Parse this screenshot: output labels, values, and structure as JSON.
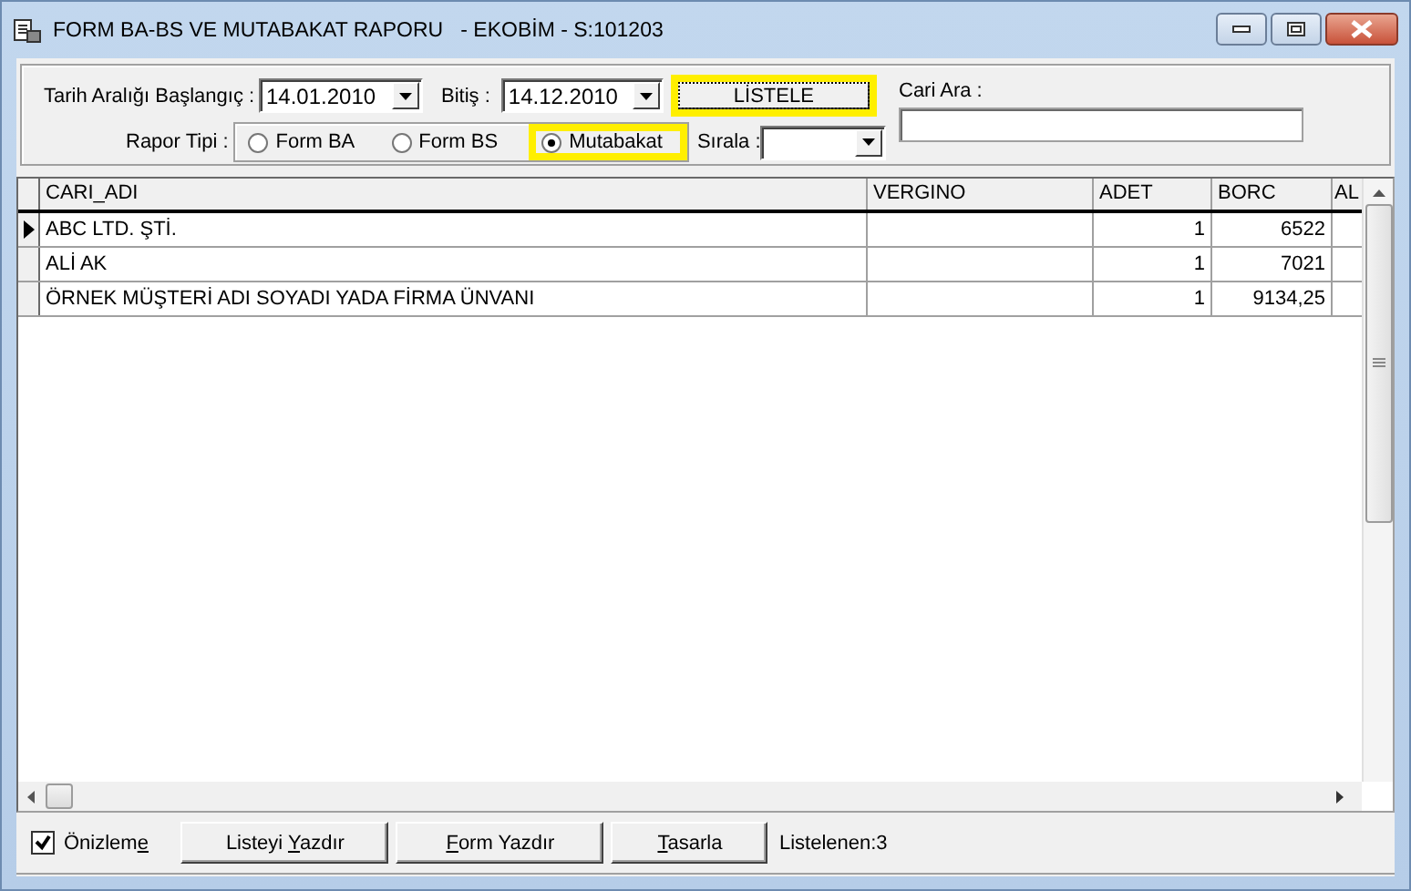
{
  "window": {
    "title": "FORM BA-BS VE MUTABAKAT RAPORU   - EKOBİM - S:101203"
  },
  "filters": {
    "start_label": "Tarih Aralığı Başlangıç :",
    "start_date": "14.01.2010",
    "end_label": "Bitiş :",
    "end_date": "14.12.2010",
    "list_button": "LİSTELE",
    "search_label": "Cari Ara :",
    "report_type_label": "Rapor Tipi :",
    "report_types": [
      {
        "label": "Form BA",
        "selected": false,
        "highlighted": false
      },
      {
        "label": "Form BS",
        "selected": false,
        "highlighted": false
      },
      {
        "label": "Mutabakat",
        "selected": true,
        "highlighted": true
      }
    ],
    "sort_label": "Sırala :"
  },
  "table": {
    "columns": [
      "CARI_ADI",
      "VERGINO",
      "ADET",
      "BORC",
      "AL"
    ],
    "rows": [
      {
        "current": true,
        "cells": [
          "ABC LTD. ŞTİ.",
          "",
          "1",
          "6522",
          ""
        ]
      },
      {
        "current": false,
        "cells": [
          "ALİ AK",
          "",
          "1",
          "7021",
          ""
        ]
      },
      {
        "current": false,
        "cells": [
          "ÖRNEK MÜŞTERİ ADI SOYADI YADA FİRMA ÜNVANI",
          "",
          "1",
          "9134,25",
          ""
        ]
      }
    ]
  },
  "footer": {
    "preview": {
      "before": "Önizlem",
      "accel": "e",
      "checked": true
    },
    "buttons": [
      {
        "before": "Listeyi ",
        "accel": "Y",
        "after": "azdır"
      },
      {
        "accel": "F",
        "after": "orm Yazdır"
      },
      {
        "accel": "T",
        "after": "asarla"
      }
    ],
    "count": "Listelenen:3"
  }
}
